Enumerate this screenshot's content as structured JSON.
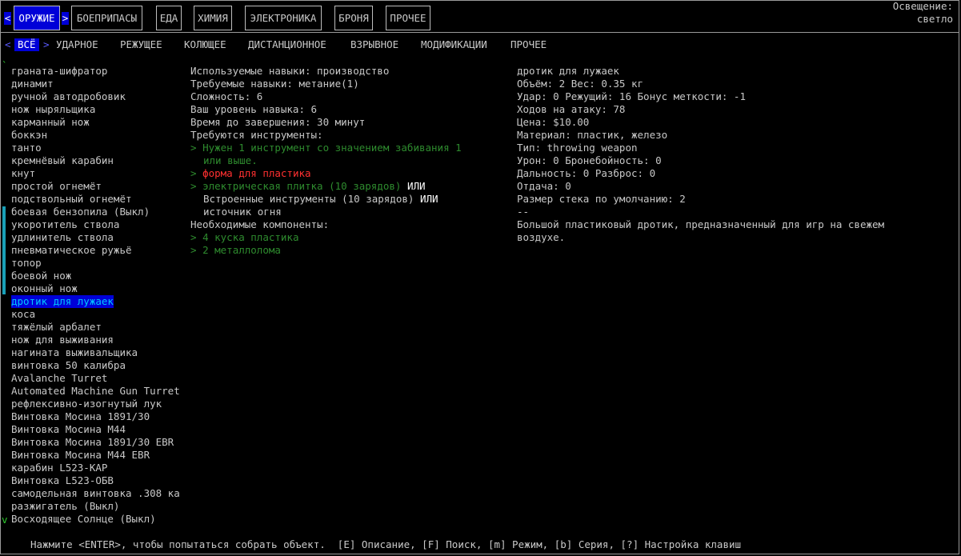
{
  "categories": [
    {
      "label": "ОРУЖИЕ",
      "active": true
    },
    {
      "label": "БОЕПРИПАСЫ"
    },
    {
      "label": "ЕДА"
    },
    {
      "label": "ХИМИЯ"
    },
    {
      "label": "ЭЛЕКТРОНИКА"
    },
    {
      "label": "БРОНЯ"
    },
    {
      "label": "ПРОЧЕЕ"
    }
  ],
  "lighting": {
    "label": "Освещение:",
    "value": "светло"
  },
  "subtabs": [
    {
      "label": "ВСЁ",
      "active": true
    },
    {
      "label": "УДАРНОЕ"
    },
    {
      "label": "РЕЖУЩЕЕ"
    },
    {
      "label": "КОЛЮЩЕЕ"
    },
    {
      "label": "ДИСТАНЦИОННОЕ"
    },
    {
      "label": "ВЗРЫВНОЕ"
    },
    {
      "label": "МОДИФИКАЦИИ"
    },
    {
      "label": "ПРОЧЕЕ"
    }
  ],
  "arrows": {
    "left": "<",
    "right": ">"
  },
  "recipes": [
    "граната-шифратор",
    "динамит",
    "ручной автодробовик",
    "нож ныряльщика",
    "карманный нож",
    "боккэн",
    "танто",
    "кремнёвый карабин",
    "кнут",
    "простой огнемёт",
    "подствольный огнемёт",
    "боевая бензопила (Выкл)",
    "укоротитель ствола",
    "удлинитель ствола",
    "пневматическое ружьё",
    "топор",
    "боевой нож",
    "оконный нож",
    "дротик для лужаек",
    "коса",
    "тяжёлый арбалет",
    "нож для выживания",
    "нагината выживальщика",
    "винтовка 50 калибра",
    "Avalanche Turret",
    "Automated Machine Gun Turret",
    "рефлексивно-изогнутый лук",
    "Винтовка Мосина 1891/30",
    "Винтовка Мосина М44",
    "Винтовка Мосина 1891/30 EBR",
    "Винтовка Мосина М44 EBR",
    "карабин L523-КАР",
    "Винтовка L523-ОБВ",
    "самодельная винтовка .308 ка",
    "разжигатель (Выкл)",
    "Восходящее Солнце (Выкл)"
  ],
  "selected_index": 18,
  "details": {
    "skills_used": "Используемые навыки: производство",
    "skills_required": "Требуемые навыки: метание(1)",
    "difficulty": "Сложность: 6",
    "your_level": "Ваш уровень навыка: 6",
    "time": "Время до завершения: 30 минут",
    "tools_header": "Требуются инструменты:",
    "tool1_line1": "Нужен 1 инструмент со значением забивания 1",
    "tool1_line2": "или выше.",
    "tool2": "форма для пластика",
    "tool3": "электрическая плитка (10 зарядов)",
    "or": "ИЛИ",
    "tool4": "Встроенные инструменты (10 зарядов)",
    "tool5": "источник огня",
    "components_header": "Необходимые компоненты:",
    "comp1": "4 куска пластика",
    "comp2": "2 металлолома",
    "bullet": ">"
  },
  "item": {
    "name": "дротик для лужаек",
    "volume_weight": "Объём: 2 Вес: 0.35 кг",
    "hit": "Удар: 0 Режущий: 16 Бонус меткости: -1",
    "moves": "Ходов на атаку: 78",
    "price": "Цена: $10.00",
    "material": "Материал: пластик, железо",
    "type": "Тип: throwing weapon",
    "damage": "Урон: 0 Бронебойность: 0",
    "range": "Дальность: 0 Разброс: 0",
    "recoil": "Отдача: 0",
    "stack": "Размер стека по умолчанию: 2",
    "dash": "--",
    "desc1": "Большой пластиковый дротик, предназначенный для игр на свежем",
    "desc2": "воздухе."
  },
  "footer": "Нажмите <ENTER>, чтобы попытаться собрать объект.  [E] Описание, [F] Поиск, [m] Режим, [b] Серия, [?] Настройка клавиш",
  "marks": {
    "top": "`",
    "bottom": "v"
  }
}
